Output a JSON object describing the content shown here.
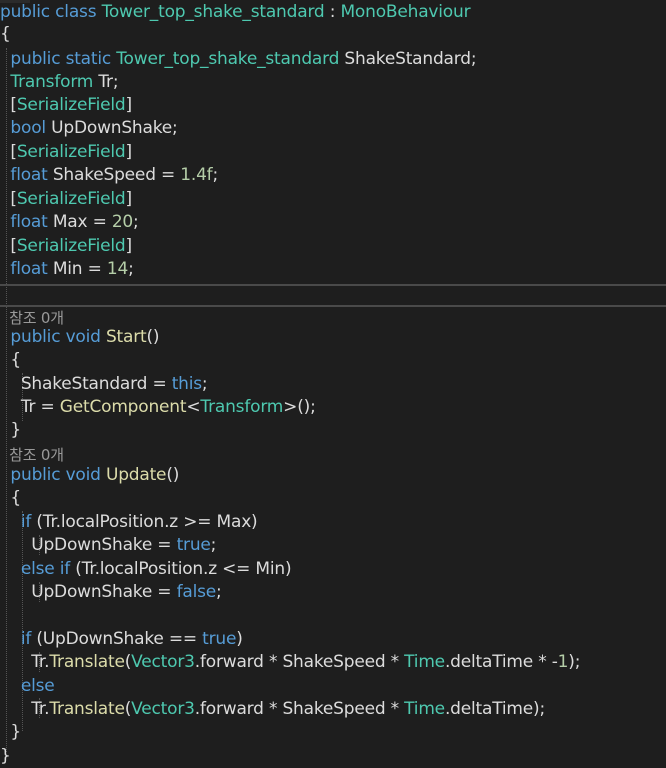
{
  "colors": {
    "background": "#1e1e1e",
    "keyword": "#569cd6",
    "type": "#4ec9b0",
    "default": "#dcdcdc",
    "number": "#b5cea8",
    "method": "#dcdcaa",
    "codelens": "#999999",
    "separator": "#4a4a4a"
  },
  "lines": [
    [
      {
        "t": "public ",
        "c": "keyword"
      },
      {
        "t": "class ",
        "c": "keyword"
      },
      {
        "t": "Tower_top_shake_standard",
        "c": "type"
      },
      {
        "t": " : ",
        "c": "default"
      },
      {
        "t": "MonoBehaviour",
        "c": "type"
      }
    ],
    [
      {
        "t": "{",
        "c": "default"
      }
    ],
    [
      {
        "t": "  public ",
        "c": "keyword"
      },
      {
        "t": "static ",
        "c": "keyword"
      },
      {
        "t": "Tower_top_shake_standard",
        "c": "type"
      },
      {
        "t": " ShakeStandard;",
        "c": "default"
      }
    ],
    [
      {
        "t": "  Transform",
        "c": "type"
      },
      {
        "t": " Tr;",
        "c": "default"
      }
    ],
    [
      {
        "t": "  [",
        "c": "default"
      },
      {
        "t": "SerializeField",
        "c": "type"
      },
      {
        "t": "]",
        "c": "default"
      }
    ],
    [
      {
        "t": "  bool",
        "c": "keyword"
      },
      {
        "t": " UpDownShake;",
        "c": "default"
      }
    ],
    [
      {
        "t": "  [",
        "c": "default"
      },
      {
        "t": "SerializeField",
        "c": "type"
      },
      {
        "t": "]",
        "c": "default"
      }
    ],
    [
      {
        "t": "  float",
        "c": "keyword"
      },
      {
        "t": " ShakeSpeed = ",
        "c": "default"
      },
      {
        "t": "1.4f",
        "c": "number"
      },
      {
        "t": ";",
        "c": "default"
      }
    ],
    [
      {
        "t": "  [",
        "c": "default"
      },
      {
        "t": "SerializeField",
        "c": "type"
      },
      {
        "t": "]",
        "c": "default"
      }
    ],
    [
      {
        "t": "  float",
        "c": "keyword"
      },
      {
        "t": " Max = ",
        "c": "default"
      },
      {
        "t": "20",
        "c": "number"
      },
      {
        "t": ";",
        "c": "default"
      }
    ],
    [
      {
        "t": "  [",
        "c": "default"
      },
      {
        "t": "SerializeField",
        "c": "type"
      },
      {
        "t": "]",
        "c": "default"
      }
    ],
    [
      {
        "t": "  float",
        "c": "keyword"
      },
      {
        "t": " Min = ",
        "c": "default"
      },
      {
        "t": "14",
        "c": "number"
      },
      {
        "t": ";",
        "c": "default"
      }
    ],
    [],
    [
      {
        "t": "  참조 0개",
        "c": "codelens"
      }
    ],
    [
      {
        "t": "  public ",
        "c": "keyword"
      },
      {
        "t": "void ",
        "c": "keyword"
      },
      {
        "t": "Start",
        "c": "method"
      },
      {
        "t": "()",
        "c": "default"
      }
    ],
    [
      {
        "t": "  {",
        "c": "default"
      }
    ],
    [
      {
        "t": "    ShakeStandard = ",
        "c": "default"
      },
      {
        "t": "this",
        "c": "keyword"
      },
      {
        "t": ";",
        "c": "default"
      }
    ],
    [
      {
        "t": "    Tr = ",
        "c": "default"
      },
      {
        "t": "GetComponent",
        "c": "method"
      },
      {
        "t": "<",
        "c": "default"
      },
      {
        "t": "Transform",
        "c": "type"
      },
      {
        "t": ">();",
        "c": "default"
      }
    ],
    [
      {
        "t": "  }",
        "c": "default"
      }
    ],
    [
      {
        "t": "  참조 0개",
        "c": "codelens"
      }
    ],
    [
      {
        "t": "  public ",
        "c": "keyword"
      },
      {
        "t": "void ",
        "c": "keyword"
      },
      {
        "t": "Update",
        "c": "method"
      },
      {
        "t": "()",
        "c": "default"
      }
    ],
    [
      {
        "t": "  {",
        "c": "default"
      }
    ],
    [
      {
        "t": "    if",
        "c": "keyword"
      },
      {
        "t": " (Tr.localPosition.z >= Max)",
        "c": "default"
      }
    ],
    [
      {
        "t": "      UpDownShake = ",
        "c": "default"
      },
      {
        "t": "true",
        "c": "keyword"
      },
      {
        "t": ";",
        "c": "default"
      }
    ],
    [
      {
        "t": "    else ",
        "c": "keyword"
      },
      {
        "t": "if",
        "c": "keyword"
      },
      {
        "t": " (Tr.localPosition.z <= Min)",
        "c": "default"
      }
    ],
    [
      {
        "t": "      UpDownShake = ",
        "c": "default"
      },
      {
        "t": "false",
        "c": "keyword"
      },
      {
        "t": ";",
        "c": "default"
      }
    ],
    [],
    [
      {
        "t": "    if",
        "c": "keyword"
      },
      {
        "t": " (UpDownShake == ",
        "c": "default"
      },
      {
        "t": "true",
        "c": "keyword"
      },
      {
        "t": ")",
        "c": "default"
      }
    ],
    [
      {
        "t": "      Tr.",
        "c": "default"
      },
      {
        "t": "Translate",
        "c": "method"
      },
      {
        "t": "(",
        "c": "default"
      },
      {
        "t": "Vector3",
        "c": "type"
      },
      {
        "t": ".forward * ShakeSpeed * ",
        "c": "default"
      },
      {
        "t": "Time",
        "c": "type"
      },
      {
        "t": ".deltaTime * -",
        "c": "default"
      },
      {
        "t": "1",
        "c": "number"
      },
      {
        "t": ");",
        "c": "default"
      }
    ],
    [
      {
        "t": "    else",
        "c": "keyword"
      }
    ],
    [
      {
        "t": "      Tr.",
        "c": "default"
      },
      {
        "t": "Translate",
        "c": "method"
      },
      {
        "t": "(",
        "c": "default"
      },
      {
        "t": "Vector3",
        "c": "type"
      },
      {
        "t": ".forward * ShakeSpeed * ",
        "c": "default"
      },
      {
        "t": "Time",
        "c": "type"
      },
      {
        "t": ".deltaTime);",
        "c": "default"
      }
    ],
    [
      {
        "t": "  }",
        "c": "default"
      }
    ],
    [
      {
        "t": "}",
        "c": "default"
      }
    ]
  ]
}
